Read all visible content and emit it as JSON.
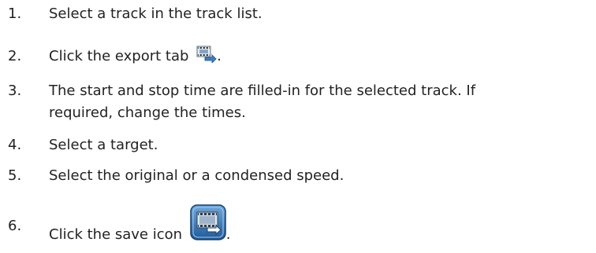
{
  "steps": [
    {
      "number": "1.",
      "text": "Select a track in the track list."
    },
    {
      "number": "2.",
      "text": "Click the export tab",
      "trailing": ".",
      "icon": "export-tab-icon"
    },
    {
      "number": "3.",
      "text": "The start and stop time are filled-in for the selected track. If",
      "text_line2": "required, change the times."
    },
    {
      "number": "4.",
      "text": "Select a target."
    },
    {
      "number": "5.",
      "text": "Select the original or a condensed speed."
    },
    {
      "number": "6.",
      "text": "Click the save icon",
      "trailing": ".",
      "icon": "save-icon"
    }
  ],
  "colors": {
    "text": "#222222",
    "icon_blue": "#3b7fc4",
    "icon_dark_blue": "#1f4f8a",
    "icon_gray": "#9aa3ad"
  }
}
